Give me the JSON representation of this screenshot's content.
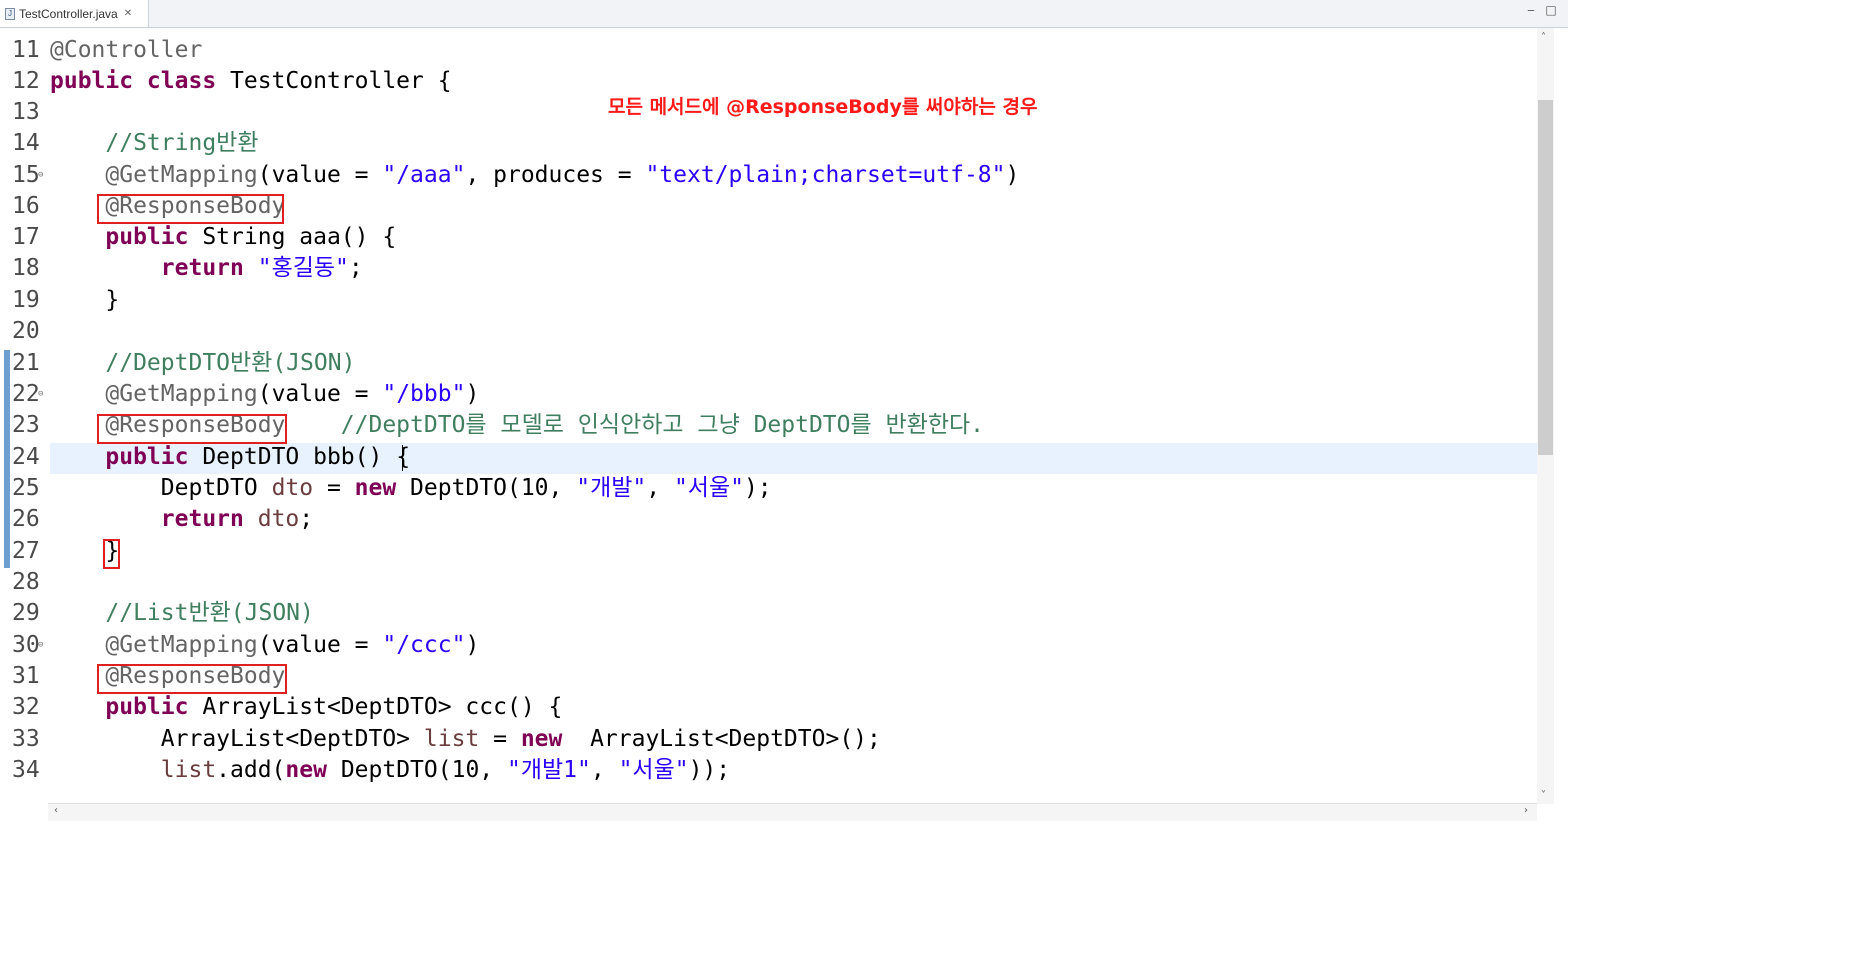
{
  "tab": {
    "filename": "TestController.java",
    "close": "✕"
  },
  "window": {
    "minimize": "‒",
    "maximize": "□"
  },
  "note": "모든 메서드에 @ResponseBody를 써야하는 경우",
  "gutter": [
    "11",
    "12",
    "13",
    "14",
    "15",
    "16",
    "17",
    "18",
    "19",
    "20",
    "21",
    "22",
    "23",
    "24",
    "25",
    "26",
    "27",
    "28",
    "29",
    "30",
    "31",
    "32",
    "33",
    "34"
  ],
  "code": {
    "l11": "@Controller",
    "l12_kw": "public class",
    "l12_rest": " TestController {",
    "l14": "//String반환",
    "l15_ann": "@GetMapping",
    "l15_a": "(value = ",
    "l15_s1": "\"/aaa\"",
    "l15_b": ", produces = ",
    "l15_s2": "\"text/plain;charset=utf-8\"",
    "l15_c": ")",
    "l16": "@ResponseBody",
    "l17_kw": "public",
    "l17_rest": " String aaa() {",
    "l18_kw": "return",
    "l18_s": "\"홍길동\"",
    "l18_end": ";",
    "l19": "}",
    "l21": "//DeptDTO반환(JSON)",
    "l22_ann": "@GetMapping",
    "l22_a": "(value = ",
    "l22_s": "\"/bbb\"",
    "l22_c": ")",
    "l23_ann": "@ResponseBody",
    "l23_cmt": "//DeptDTO를 모델로 인식안하고 그냥 DeptDTO를 반환한다.",
    "l24_kw": "public",
    "l24_rest": " DeptDTO bbb() {",
    "l25_a": "DeptDTO ",
    "l25_var": "dto",
    "l25_b": " = ",
    "l25_kw": "new",
    "l25_c": " DeptDTO(10, ",
    "l25_s1": "\"개발\"",
    "l25_d": ", ",
    "l25_s2": "\"서울\"",
    "l25_e": ");",
    "l26_kw": "return",
    "l26_var": "dto",
    "l26_end": ";",
    "l27": "}",
    "l29": "//List반환(JSON)",
    "l30_ann": "@GetMapping",
    "l30_a": "(value = ",
    "l30_s": "\"/ccc\"",
    "l30_c": ")",
    "l31": "@ResponseBody",
    "l32_kw": "public",
    "l32_rest": " ArrayList<DeptDTO> ccc() {",
    "l33_a": "ArrayList<DeptDTO> ",
    "l33_var": "list",
    "l33_b": " = ",
    "l33_kw": "new",
    "l33_c": "  ArrayList<DeptDTO>();",
    "l34_var": "list",
    "l34_a": ".add(",
    "l34_kw": "new",
    "l34_b": " DeptDTO(10, ",
    "l34_s1": "\"개발1\"",
    "l34_c": ", ",
    "l34_s2": "\"서울\"",
    "l34_d": "));"
  },
  "colors": {
    "keyword": "#7f0055",
    "string": "#2a00ff",
    "comment": "#3f7f5f",
    "annotation": "#646464",
    "highlight_box": "#e02020",
    "note": "#ff1a1a"
  }
}
